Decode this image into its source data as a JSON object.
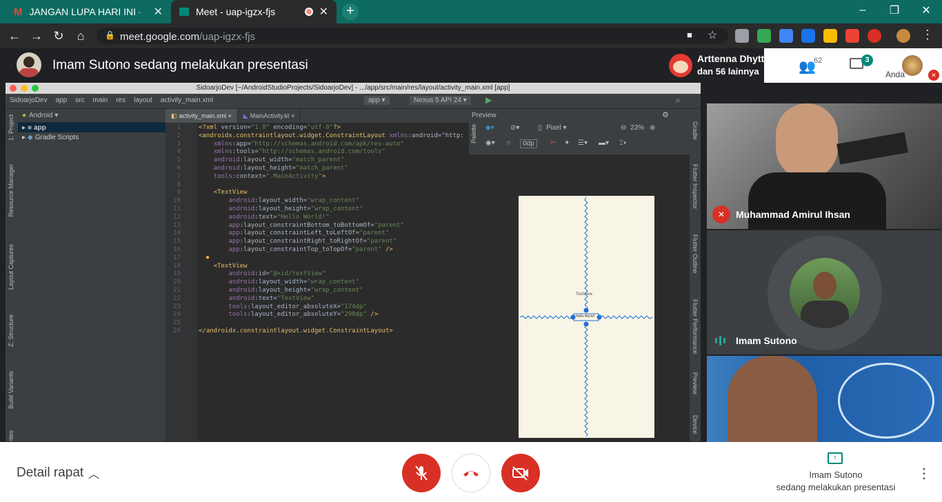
{
  "browser": {
    "tabs": [
      {
        "title": "JANGAN LUPA HARI INI - Meetup",
        "icon": "gmail-icon"
      },
      {
        "title": "Meet - uap-igzx-fjs",
        "icon": "meet-icon",
        "recording": true
      }
    ],
    "url_host": "meet.google.com",
    "url_path": "/uap-igzx-fjs",
    "colors": {
      "tabbar": "#0e6b62",
      "toolbar": "#2b2b2b"
    }
  },
  "meet": {
    "presenting_title": "Imam Sutono sedang melakukan presentasi",
    "participants_preview": {
      "name": "Arttenna Dhytty...",
      "others": "dan 56 lainnya"
    },
    "people_count": "62",
    "chat_badge": "3",
    "self_label": "Anda",
    "tiles": [
      {
        "name": "Muhammad Amirul Ihsan",
        "muted": true
      },
      {
        "name": "Imam Sutono",
        "speaking": true
      },
      {
        "name": "",
        "video": true
      }
    ],
    "bottom": {
      "details_label": "Detail rapat",
      "presenting_line1": "Imam Sutono",
      "presenting_line2": "sedang melakukan presentasi"
    },
    "colors": {
      "danger": "#d93025",
      "accent": "#00897b"
    }
  },
  "ide": {
    "title": "SidoarjoDev [~/AndroidStudioProjects/SidoarjoDev] - .../app/src/main/res/layout/activity_main.xml [app]",
    "breadcrumbs": [
      "SidoarjoDev",
      "app",
      "src",
      "main",
      "res",
      "layout",
      "activity_main.xml"
    ],
    "run_config": "app",
    "device": "Nexus 5 API 24",
    "project_view": "Android",
    "tree": [
      "app",
      "Gradle Scripts"
    ],
    "left_tools": [
      "1: Project",
      "Resource Manager",
      "Layout Captures",
      "Z: Structure",
      "Build Variants",
      "rites"
    ],
    "right_tools": [
      "Gradle",
      "Flutter Inspector",
      "Flutter Outline",
      "Flutter Performance",
      "Preview",
      "Device"
    ],
    "editor_tabs": [
      "activity_main.xml",
      "MainActivity.kt"
    ],
    "preview_label": "Preview",
    "palette_label": "Palette",
    "pixel_device": "Pixel",
    "zoom": "23%",
    "margin": "0dp",
    "device_text_1": "TextView",
    "device_text_2": "Hello World!",
    "code_lines": [
      {
        "n": "1",
        "t": "<?xml version=\"1.0\" encoding=\"utf-8\"?>"
      },
      {
        "n": "2",
        "t": "<androidx.constraintlayout.widget.ConstraintLayout xmlns:android=\"http:"
      },
      {
        "n": "3",
        "t": "    xmlns:app=\"http://schemas.android.com/apk/res-auto\""
      },
      {
        "n": "4",
        "t": "    xmlns:tools=\"http://schemas.android.com/tools\""
      },
      {
        "n": "5",
        "t": "    android:layout_width=\"match_parent\""
      },
      {
        "n": "6",
        "t": "    android:layout_height=\"match_parent\""
      },
      {
        "n": "7",
        "t": "    tools:context=\".MainActivity\">"
      },
      {
        "n": "8",
        "t": ""
      },
      {
        "n": "9",
        "t": "    <TextView"
      },
      {
        "n": "10",
        "t": "        android:layout_width=\"wrap_content\""
      },
      {
        "n": "11",
        "t": "        android:layout_height=\"wrap_content\""
      },
      {
        "n": "12",
        "t": "        android:text=\"Hello World!\""
      },
      {
        "n": "13",
        "t": "        app:layout_constraintBottom_toBottomOf=\"parent\""
      },
      {
        "n": "14",
        "t": "        app:layout_constraintLeft_toLeftOf=\"parent\""
      },
      {
        "n": "15",
        "t": "        app:layout_constraintRight_toRightOf=\"parent\""
      },
      {
        "n": "16",
        "t": "        app:layout_constraintTop_toTopOf=\"parent\" />"
      },
      {
        "n": "17",
        "t": ""
      },
      {
        "n": "18",
        "t": "    <TextView"
      },
      {
        "n": "19",
        "t": "        android:id=\"@+id/textView\""
      },
      {
        "n": "20",
        "t": "        android:layout_width=\"wrap_content\""
      },
      {
        "n": "21",
        "t": "        android:layout_height=\"wrap_content\""
      },
      {
        "n": "22",
        "t": "        android:text=\"TextView\""
      },
      {
        "n": "23",
        "t": "        tools:layout_editor_absoluteX=\"174dp\""
      },
      {
        "n": "24",
        "t": "        tools:layout_editor_absoluteY=\"290dp\" />"
      },
      {
        "n": "25",
        "t": ""
      },
      {
        "n": "26",
        "t": "</androidx.constraintlayout.widget.ConstraintLayout>"
      }
    ]
  }
}
